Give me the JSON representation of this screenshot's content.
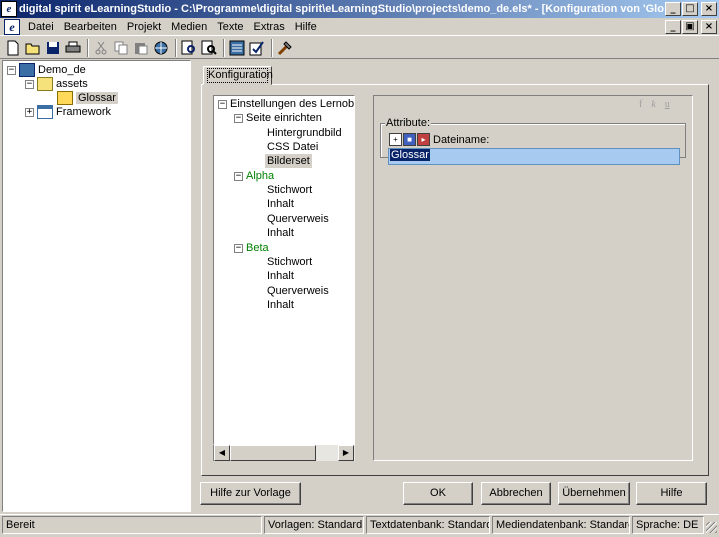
{
  "window": {
    "title": "digital spirit eLearningStudio - C:\\Programme\\digital spirit\\eLearningStudio\\projects\\demo_de.els* - [Konfiguration von 'Glo...",
    "controls": [
      "_",
      "□",
      "×"
    ]
  },
  "menu": {
    "items": [
      "Datei",
      "Bearbeiten",
      "Projekt",
      "Medien",
      "Texte",
      "Extras",
      "Hilfe"
    ],
    "mdi_controls": [
      "_",
      "▣",
      "×"
    ]
  },
  "toolbar": {
    "icons": [
      "new-icon",
      "open-icon",
      "save-icon",
      "print-icon",
      "cut-icon",
      "copy-icon",
      "paste-icon",
      "globe-icon",
      "preview-icon",
      "preview-search-icon",
      "config-icon",
      "check-icon",
      "tools-icon"
    ]
  },
  "project_tree": {
    "root": "Demo_de",
    "assets": "assets",
    "glossar": "Glossar",
    "framework": "Framework"
  },
  "tab": {
    "label": "Konfiguration"
  },
  "settings_tree": {
    "root": "Einstellungen des Lernobjekt",
    "page_setup": "Seite einrichten",
    "page_items": [
      "Hintergrundbild",
      "CSS Datei",
      "Bilderset"
    ],
    "alpha": "Alpha",
    "alpha_items": [
      "Stichwort",
      "Inhalt",
      "Querverweis",
      "Inhalt"
    ],
    "beta": "Beta",
    "beta_items": [
      "Stichwort",
      "Inhalt",
      "Querverweis",
      "Inhalt"
    ],
    "selected": "Bilderset"
  },
  "format_icons": [
    "f",
    "k",
    "u"
  ],
  "attribute_group": {
    "label": "Attribute:",
    "field_label": "Dateiname:",
    "field_value": "Glossar"
  },
  "buttons": {
    "help_template": "Hilfe zur Vorlage",
    "ok": "OK",
    "cancel": "Abbrechen",
    "apply": "Übernehmen",
    "help": "Hilfe"
  },
  "statusbar": {
    "state": "Bereit",
    "templates": "Vorlagen: Standard",
    "text_db": "Textdatenbank: Standard",
    "media_db": "Mediendatenbank: Standard",
    "language": "Sprache: DE"
  },
  "colors": {
    "titlebar_start": "#0a246a",
    "titlebar_end": "#a6caf0",
    "face": "#d4d0c8",
    "green_nodes": "#008000",
    "input_highlight": "#a6caf0"
  }
}
